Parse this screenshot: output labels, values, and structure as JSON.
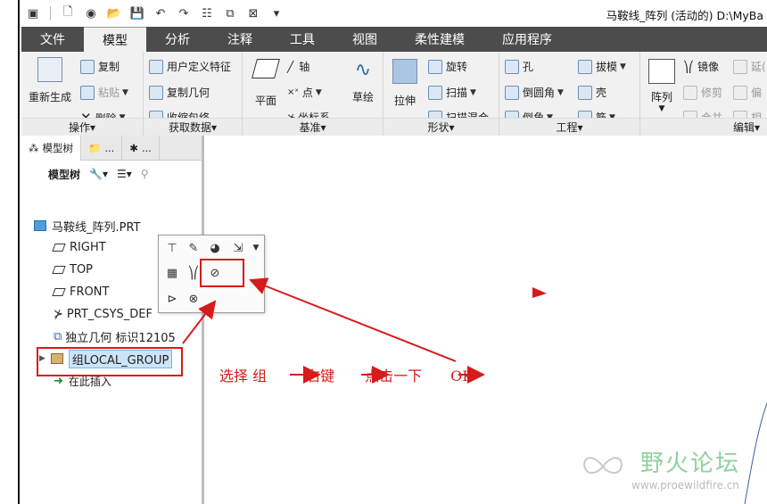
{
  "qat": {
    "title": "马鞍线_阵列 (活动的) D:\\MyBa"
  },
  "tabs": [
    "文件",
    "模型",
    "分析",
    "注释",
    "工具",
    "视图",
    "柔性建模",
    "应用程序"
  ],
  "ribbon": {
    "groups": {
      "operations": "操作▾",
      "get_data": "获取数据▾",
      "datum": "基准▾",
      "shapes": "形状▾",
      "engineering": "工程▾",
      "editing": "编辑▾"
    },
    "regenerate": "重新生成",
    "copy": "复制",
    "paste": "粘贴",
    "delete": "删除",
    "user_feature": "用户定义特征",
    "copy_geometry": "复制几何",
    "shrinkwrap": "收缩包络",
    "plane": "平面",
    "axis": "轴",
    "point": "点",
    "csys": "坐标系",
    "sketch": "草绘",
    "extrude": "拉伸",
    "revolve": "旋转",
    "sweep": "扫描",
    "swept_blend": "扫描混合",
    "hole": "孔",
    "round": "倒圆角",
    "chamfer": "倒角",
    "draft": "拔模",
    "shell": "壳",
    "rib": "筋",
    "pattern": "阵列",
    "mirror": "镜像",
    "trim": "修剪",
    "merge": "合并",
    "extend": "延(",
    "offset": "偏",
    "intersect": "相"
  },
  "panel": {
    "tab_model_tree": "模型树",
    "tab2": "...",
    "tab3": "...",
    "toolbar_label": "模型树",
    "tree": {
      "root": "马鞍线_阵列.PRT",
      "right": "RIGHT",
      "top": "TOP",
      "front": "FRONT",
      "csys": "PRT_CSYS_DEF",
      "indep_geom": "独立几何 标识12105",
      "group": "组LOCAL_GROUP",
      "insert_here": "在此插入"
    }
  },
  "annotation": {
    "step1": "选择 组",
    "step2": "右键",
    "step3": "点击一下",
    "step4": "OK"
  },
  "watermark": {
    "title": "野火论坛",
    "url": "www.proewildfire.cn"
  },
  "colors": {
    "annotation_red": "#d71a1a",
    "tab_bar": "#4c4c4c",
    "ribbon_bg": "#f1f1f1"
  }
}
